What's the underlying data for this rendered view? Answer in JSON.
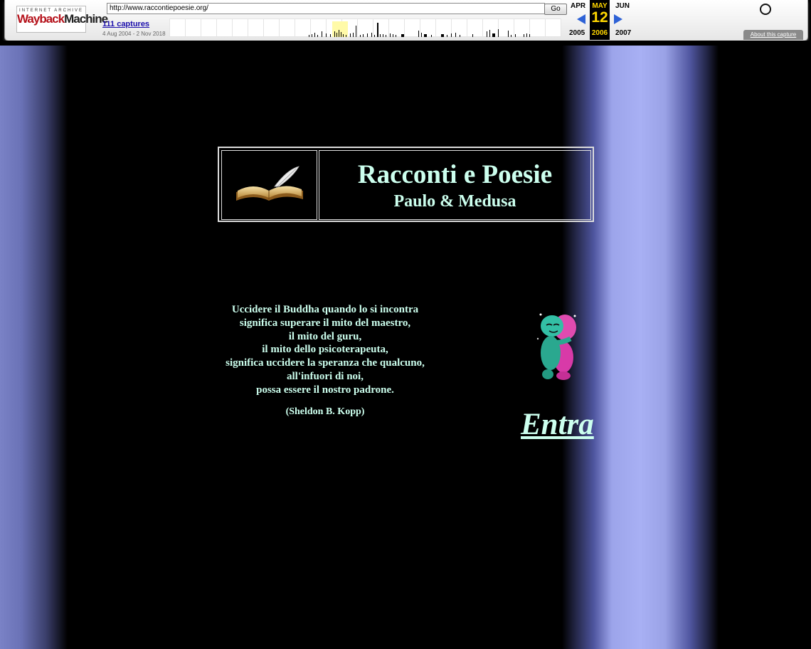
{
  "wayback": {
    "logo_line1": "INTERNET ARCHIVE",
    "logo_word1": "Wayback",
    "logo_word2": "Machine",
    "url": "http://www.raccontiepoesie.org/",
    "go_label": "Go",
    "captures_label": "111 captures",
    "date_range": "4 Aug 2004 - 2 Nov 2018",
    "prev_month": "APR",
    "current_month": "MAY",
    "next_month": "JUN",
    "current_day": "12",
    "prev_year": "2005",
    "current_year": "2006",
    "next_year": "2007",
    "about_label": "About this capture",
    "highlight_color": "#ffd700",
    "arrow_color": "#2e62d6"
  },
  "header": {
    "title": "Racconti e Poesie",
    "subtitle": "Paulo & Medusa",
    "book_icon": "open-book-with-quill-icon"
  },
  "quote": {
    "lines": [
      "Uccidere il Buddha quando lo si incontra",
      "significa superare il mito del maestro,",
      "il mito del guru,",
      "il mito dello psicoterapeuta,",
      "significa uccidere la speranza che qualcuno,",
      "all'infuori di noi,",
      "possa essere il nostro padrone."
    ],
    "author": "(Sheldon B. Kopp)"
  },
  "enter_link": "Entra",
  "hug_icon": "hugging-couple-icon",
  "colors": {
    "text": "#ccffee",
    "background": "#000000",
    "stripe": "#a8b0f4"
  }
}
